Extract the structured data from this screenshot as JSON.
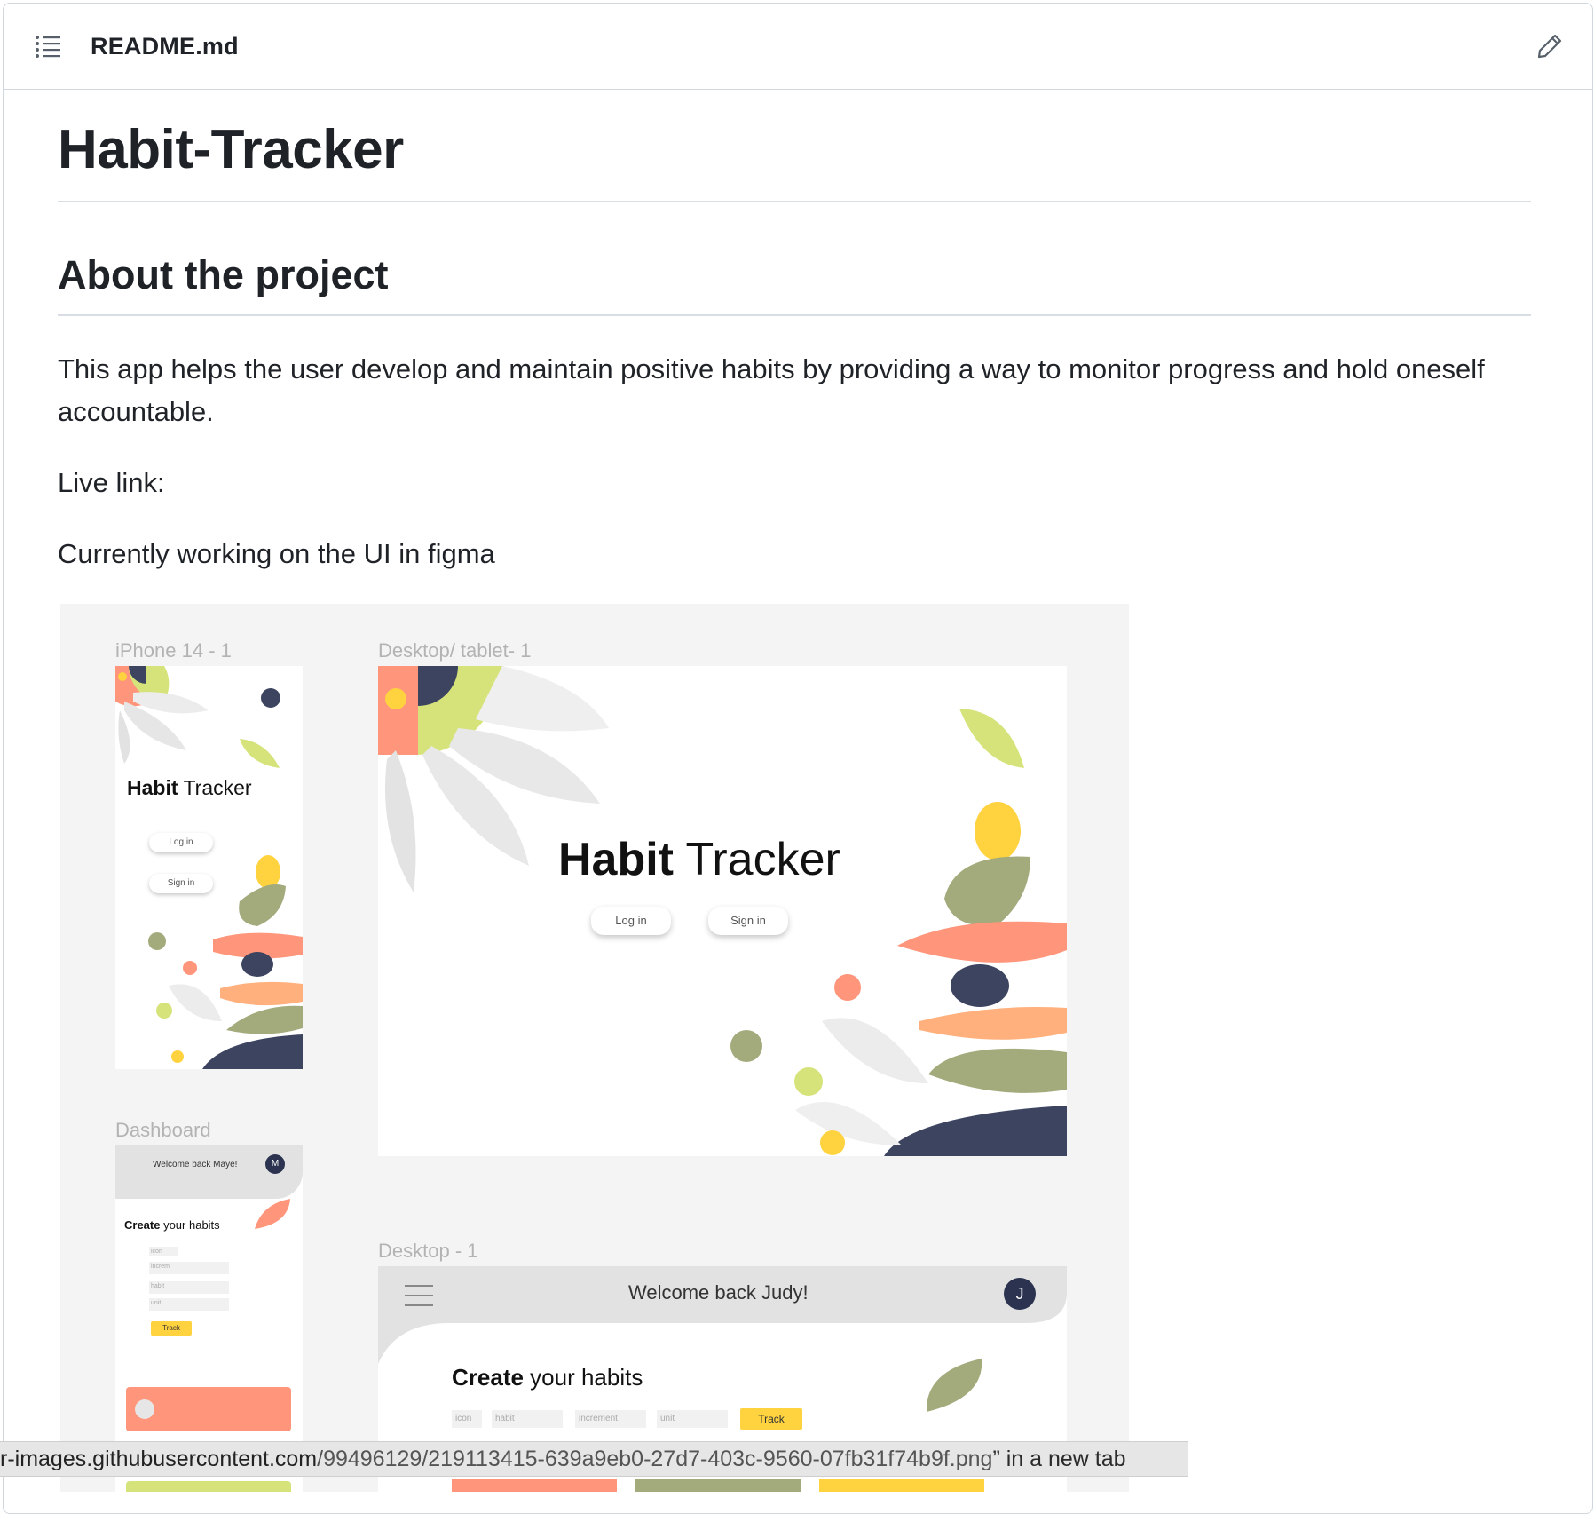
{
  "file": {
    "name": "README.md"
  },
  "readme": {
    "title": "Habit-Tracker",
    "section_title": "About the project",
    "description": "This app helps the user develop and maintain positive habits by providing a way to monitor progress and hold oneself accountable.",
    "live_link": "Live link:",
    "figma_note": "Currently working on the UI in figma"
  },
  "figma": {
    "iphone_label": "iPhone 14 - 1",
    "tablet_label": "Desktop/ tablet- 1",
    "dashboard_label": "Dashboard",
    "desktop_label": "Desktop - 1",
    "title_bold": "Habit",
    "title_light": " Tracker",
    "login": "Log in",
    "signin": "Sign in",
    "welcome_maye": "Welcome back Maye!",
    "avatar_m": "M",
    "welcome_judy": "Welcome back Judy!",
    "avatar_j": "J",
    "create_bold": "Create",
    "create_light": " your habits",
    "field_icon": "icon",
    "field_habit": "habit",
    "field_increment": "increment",
    "field_unit": "unit",
    "field_increm": "increm",
    "track": "Track"
  },
  "status": {
    "url_host": "r-images.githubusercontent.com",
    "url_path": "/99496129/219113415-639a9eb0-27d7-403c-9560-07fb31f74b9f.png",
    "suffix": "” in a new tab"
  },
  "colors": {
    "border": "#d0d7de",
    "text": "#1f2328",
    "salmon": "#ff957a",
    "lime": "#d6e37a",
    "yellow": "#ffd23f",
    "olive": "#a3ab7c",
    "navy": "#3c4460",
    "peach": "#ffb07c"
  }
}
